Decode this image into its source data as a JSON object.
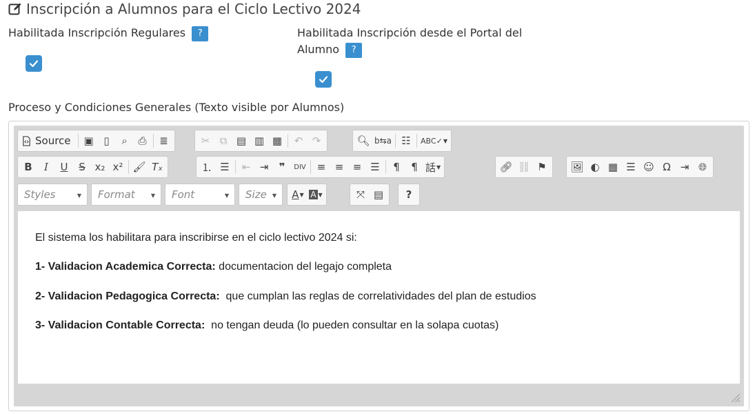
{
  "header": {
    "title": "Inscripción a Alumnos para el Ciclo Lectivo 2024",
    "icon": "edit-icon"
  },
  "fields": {
    "regulares": {
      "label": "Habilitada Inscripción Regulares",
      "help": "?",
      "checked": true
    },
    "portal": {
      "label_line1": "Habilitada Inscripción desde el Portal del",
      "label_line2": "Alumno",
      "help": "?",
      "checked": true
    }
  },
  "section": {
    "label": "Proceso y Condiciones Generales (Texto visible por Alumnos)"
  },
  "toolbar": {
    "source_label": "Source",
    "combos": {
      "styles": "Styles",
      "format": "Format",
      "font": "Font",
      "size": "Size"
    },
    "help_label": "?"
  },
  "content": {
    "intro": "El sistema los habilitara para inscribirse en el ciclo lectivo 2024 si:",
    "items": [
      {
        "bold": "1- Validacion Academica Correcta:",
        "text": " documentacion del legajo completa"
      },
      {
        "bold": "2- Validacion Pedagogica Correcta:",
        "text": "  que cumplan las reglas de correlatividades del plan de estudios"
      },
      {
        "bold": "3- Validacion Contable Correcta:",
        "text": "  no tengan deuda (lo pueden consultar en la solapa cuotas)"
      }
    ]
  },
  "colors": {
    "accent": "#3a8fcf",
    "toolbar_bg": "#d6d6d6"
  }
}
